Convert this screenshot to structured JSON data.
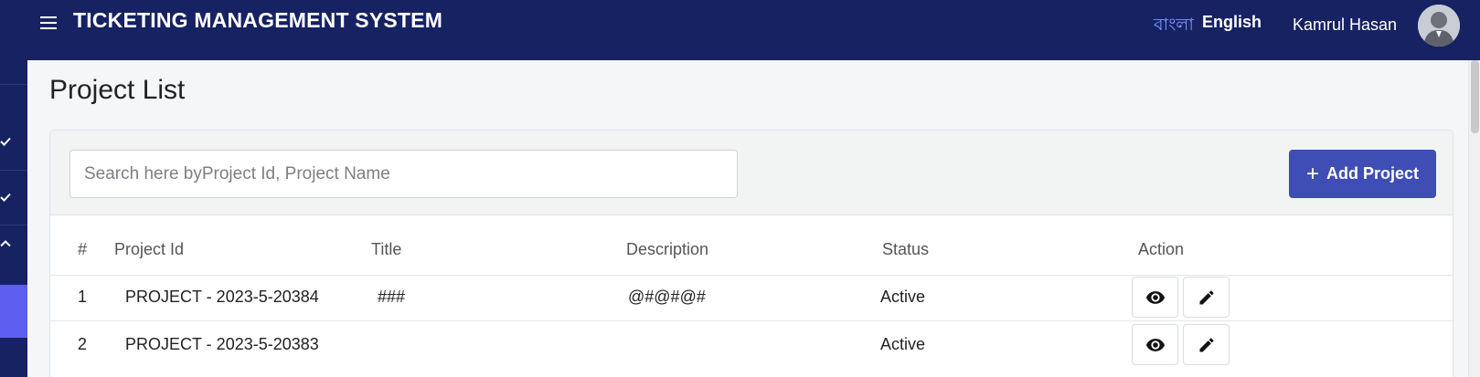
{
  "header": {
    "title": "TICKETING MANAGEMENT SYSTEM",
    "lang_bn": "বাংলা",
    "lang_en": "English",
    "user_name": "Kamrul Hasan"
  },
  "page": {
    "title": "Project List"
  },
  "search": {
    "placeholder": "Search here byProject Id, Project Name"
  },
  "toolbar": {
    "add_label": "Add Project"
  },
  "table": {
    "headers": [
      "#",
      "Project Id",
      "Title",
      "Description",
      "Status",
      "Action"
    ],
    "rows": [
      {
        "num": "1",
        "project_id": "PROJECT - 2023-5-20384",
        "title": "###",
        "description": "@#@#@#",
        "status": "Active"
      },
      {
        "num": "2",
        "project_id": "PROJECT - 2023-5-20383",
        "title": "",
        "description": "",
        "status": "Active"
      }
    ]
  },
  "colors": {
    "header_bg": "#172262",
    "accent_button": "#3f4eb4",
    "sidebar_active": "#5b5ff0",
    "lang_bn": "#7f97ff"
  },
  "icons": {
    "menu": "menu-icon",
    "sidebar_items": [
      "check-icon",
      "check-icon",
      "chevron-up-icon"
    ],
    "view": "eye-icon",
    "edit": "pencil-icon",
    "add": "plus-icon"
  }
}
